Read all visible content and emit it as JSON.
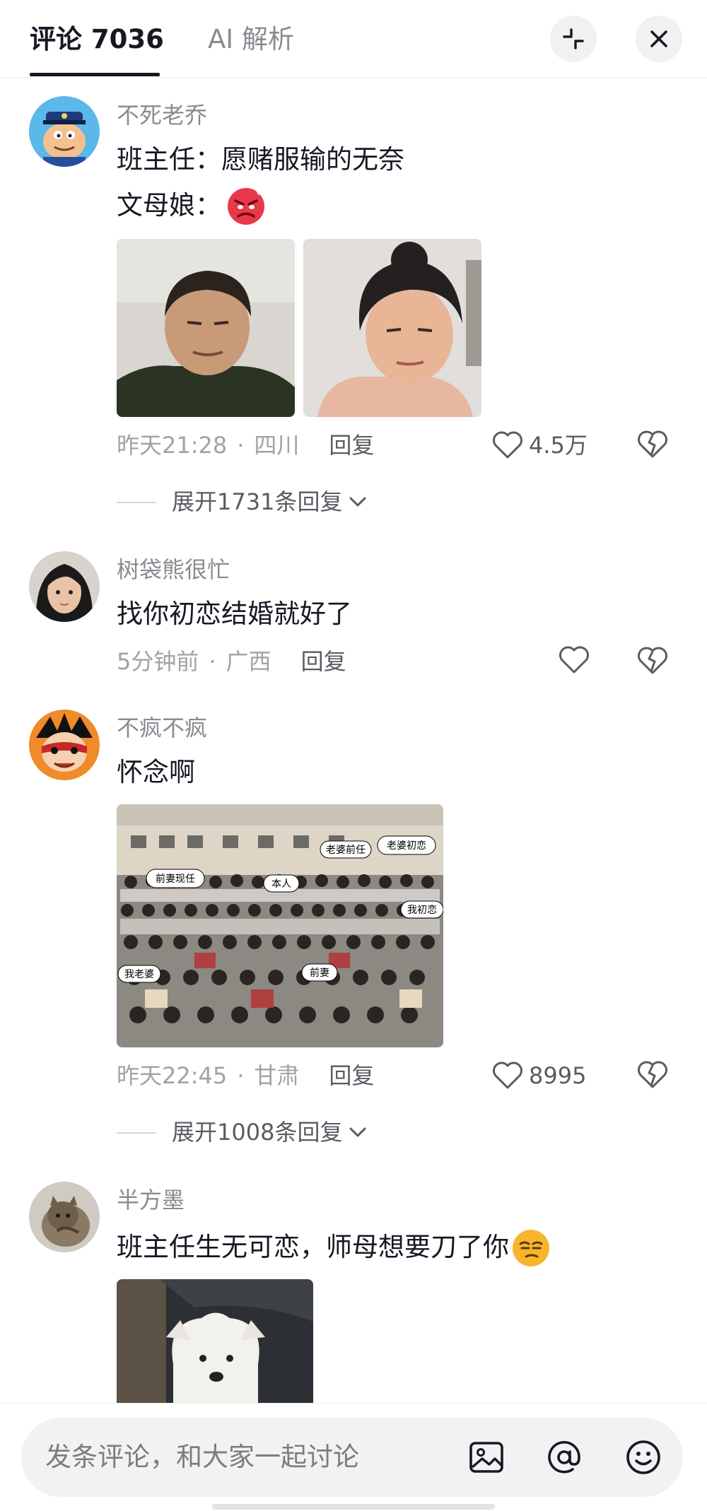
{
  "header": {
    "tab_comments": "评论 7036",
    "tab_ai": "AI 解析",
    "collapse_icon": "collapse-icon",
    "close_icon": "close-icon"
  },
  "comments": [
    {
      "username": "不死老乔",
      "lines": [
        "班主任：愿赌服输的无奈",
        "文母娘："
      ],
      "time": "昨天21:28",
      "location": "四川",
      "reply": "回复",
      "likes": "4.5万",
      "expand": "展开1731条回复"
    },
    {
      "username": "树袋熊很忙",
      "lines": [
        "找你初恋结婚就好了"
      ],
      "time": "5分钟前",
      "location": "广西",
      "reply": "回复",
      "likes": ""
    },
    {
      "username": "不疯不疯",
      "lines": [
        "怀念啊"
      ],
      "time": "昨天22:45",
      "location": "甘肃",
      "reply": "回复",
      "likes": "8995",
      "expand": "展开1008条回复",
      "photo_labels": [
        "老婆前任",
        "老婆初恋",
        "前妻现任",
        "本人",
        "我初恋",
        "我老婆",
        "前妻"
      ]
    },
    {
      "username": "半方墨",
      "lines": [
        "班主任生无可恋，师母想要刀了你"
      ]
    }
  ],
  "bottom_bar": {
    "placeholder": "发条评论，和大家一起讨论",
    "icons": [
      "image-icon",
      "at-icon",
      "emoji-icon"
    ]
  }
}
